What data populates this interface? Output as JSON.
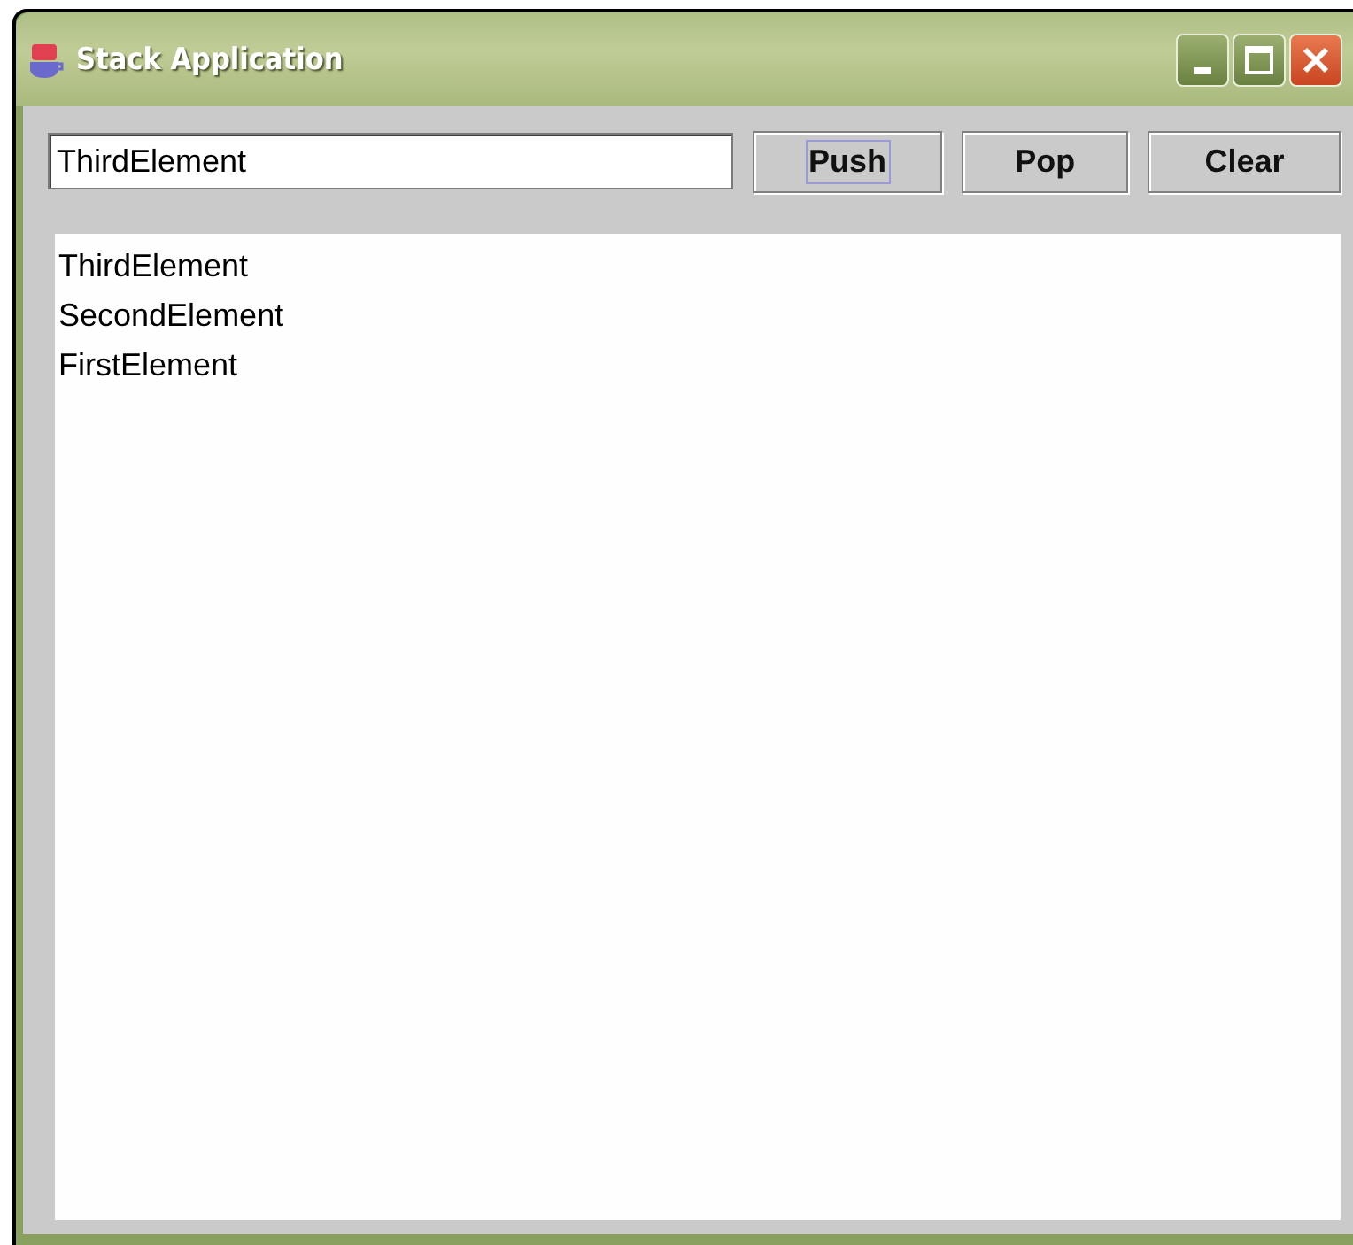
{
  "window": {
    "title": "Stack Application"
  },
  "input": {
    "value": "ThirdElement"
  },
  "buttons": [
    {
      "label": "Push",
      "focused": true
    },
    {
      "label": "Pop",
      "focused": false
    },
    {
      "label": "Clear",
      "focused": false
    }
  ],
  "list": {
    "items": [
      "ThirdElement",
      "SecondElement",
      "FirstElement"
    ]
  }
}
